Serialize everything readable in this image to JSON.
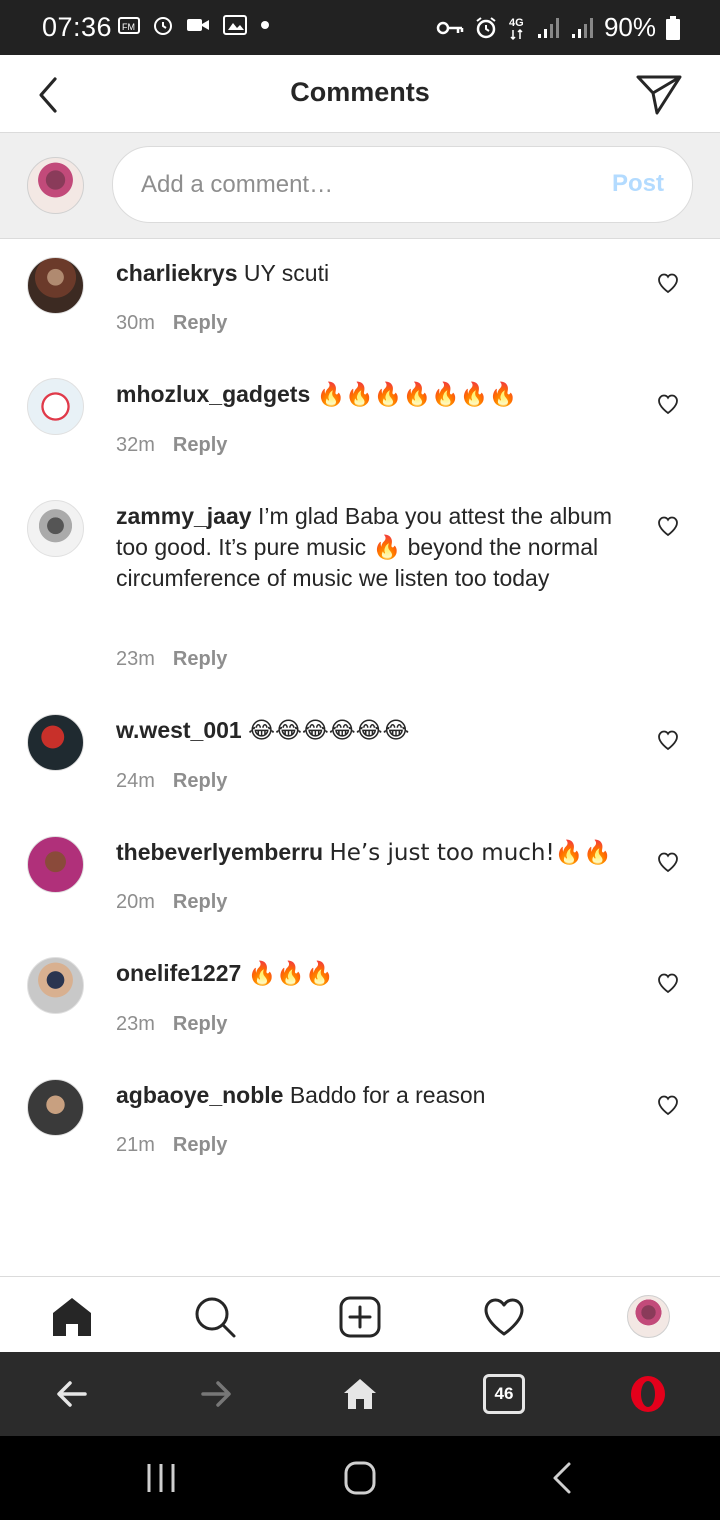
{
  "status_bar": {
    "time": "07:36",
    "battery": "90%",
    "icons_left": [
      "fm-radio-icon",
      "alarm-icon",
      "video-camera-icon",
      "gallery-icon",
      "dot-icon"
    ],
    "icons_right": [
      "key-icon",
      "alarm-icon",
      "4g-icon",
      "signal-icon",
      "signal-icon",
      "battery-icon"
    ]
  },
  "header": {
    "title": "Comments",
    "back_icon": "chevron-left-icon",
    "send_icon": "paper-plane-icon"
  },
  "composer": {
    "placeholder": "Add a comment…",
    "post_label": "Post",
    "post_color": "#b3dbff"
  },
  "comments": [
    {
      "user": "charliekrys",
      "text": "UY scuti",
      "time": "30m",
      "reply": "Reply"
    },
    {
      "user": "mhozlux_gadgets",
      "text": "🔥🔥🔥🔥🔥🔥🔥",
      "time": "32m",
      "reply": "Reply"
    },
    {
      "user": "zammy_jaay",
      "text": "I’m glad Baba you attest the album too good. It’s pure music 🔥 beyond the normal circumference of music we listen too today",
      "time": "23m",
      "reply": "Reply"
    },
    {
      "user": "w.west_001",
      "text": "😂😂😂😂😂😂",
      "time": "24m",
      "reply": "Reply"
    },
    {
      "user": "thebeverlyemberru",
      "text": "He’s just too much!🔥🔥",
      "time": "20m",
      "reply": "Reply"
    },
    {
      "user": "onelife1227",
      "text": "🔥🔥🔥",
      "time": "23m",
      "reply": "Reply"
    },
    {
      "user": "agbaoye_noble",
      "text": "Baddo for a reason",
      "time": "21m",
      "reply": "Reply"
    }
  ],
  "tab_bar": {
    "items": [
      "home-icon",
      "search-icon",
      "new-post-icon",
      "activity-heart-icon",
      "profile-avatar"
    ]
  },
  "browser_bar": {
    "tab_count": "46",
    "brand_color": "#e4001b"
  },
  "colors": {
    "text": "#262626",
    "meta": "#8e8e8e",
    "divider": "#dbdbdb"
  }
}
